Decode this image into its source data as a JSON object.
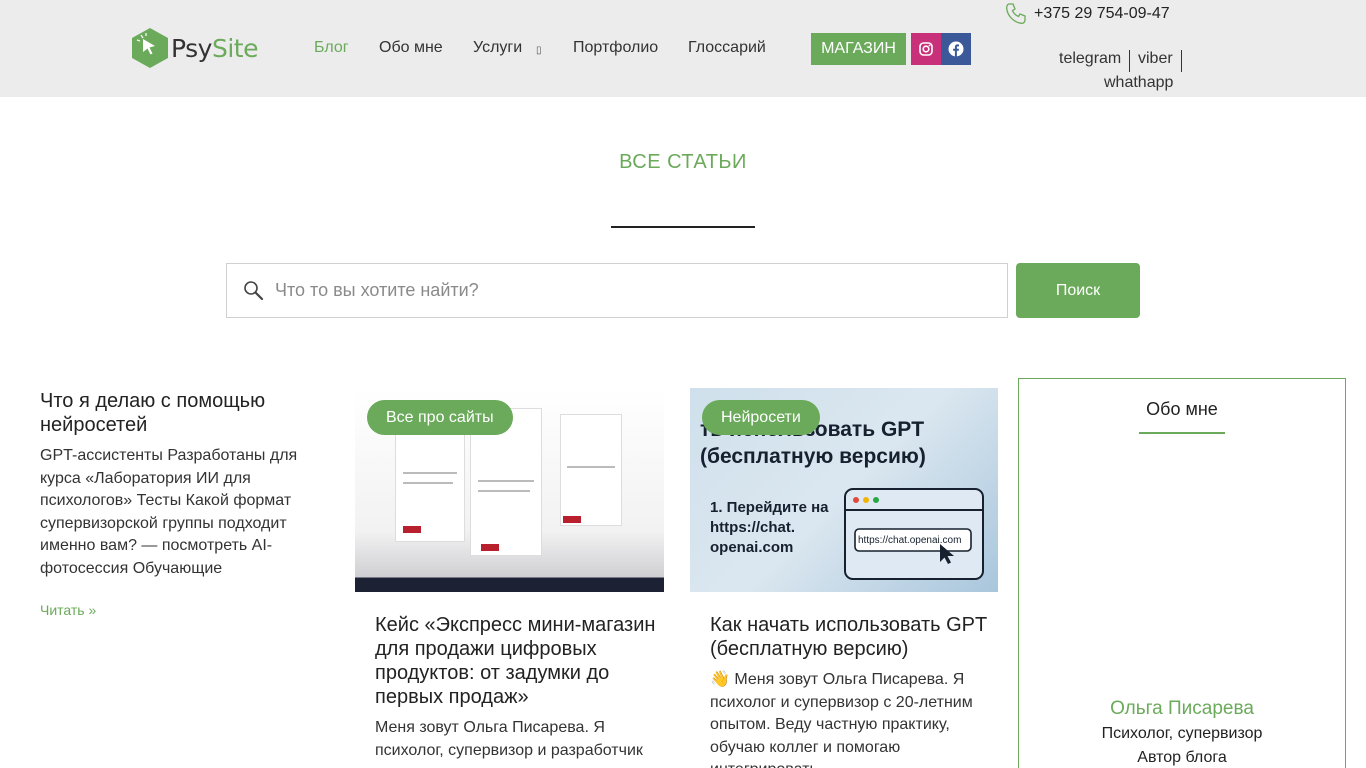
{
  "header": {
    "logo": {
      "part1": "Psy",
      "part2": "Site"
    },
    "nav": [
      {
        "label": "Блог",
        "active": true
      },
      {
        "label": "Обо мне"
      },
      {
        "label": "Услуги",
        "has_dropdown": true
      },
      {
        "label": "Портфолио"
      },
      {
        "label": "Глоссарий"
      }
    ],
    "shop_label": "МАГАЗИН",
    "phone": "+375 29 754-09-47",
    "messengers": [
      "telegram",
      "viber",
      "whathapp"
    ]
  },
  "page": {
    "title": "ВСЕ СТАТЬИ"
  },
  "search": {
    "placeholder": "Что то вы хотите найти?",
    "button_label": "Поиск"
  },
  "posts": [
    {
      "title": "Что я делаю с помощью нейросетей",
      "excerpt": "GPT-ассистенты Разработаны для курса «Лаборатория ИИ для психологов» Тесты Какой формат супервизорской группы подходит именно вам? — посмотреть AI-фотосессия Обучающие",
      "read_more": "Читать »"
    },
    {
      "badge": "Все про сайты",
      "title": "Кейс «Экспресс мини-магазин для продажи цифровых продуктов: от задумки до первых продаж»",
      "excerpt": "Меня зовут Ольга Писарева. Я психолог, супервизор и разработчик"
    },
    {
      "badge": "Нейросети",
      "title": "Как начать использовать GPT (бесплатную версию)",
      "excerpt": "👋 Меня зовут Ольга Писарева. Я психолог и супервизор с 20-летним опытом. Веду частную практику, обучаю коллег и помогаю интегрировать",
      "image_text": {
        "heading": "ть использовать GPT (бесплатную версию)",
        "step": "1. Перейдите на https://chat. openai.com",
        "url": "https://chat.openai.com"
      }
    }
  ],
  "sidebar": {
    "title": "Обо мне",
    "name": "Ольга Писарева",
    "role": "Психолог, супервизор",
    "role2": "Автор блога"
  },
  "colors": {
    "accent": "#6aaa5a",
    "instagram": "#c8317a",
    "facebook": "#3b5998",
    "header_bg": "#ececec"
  }
}
